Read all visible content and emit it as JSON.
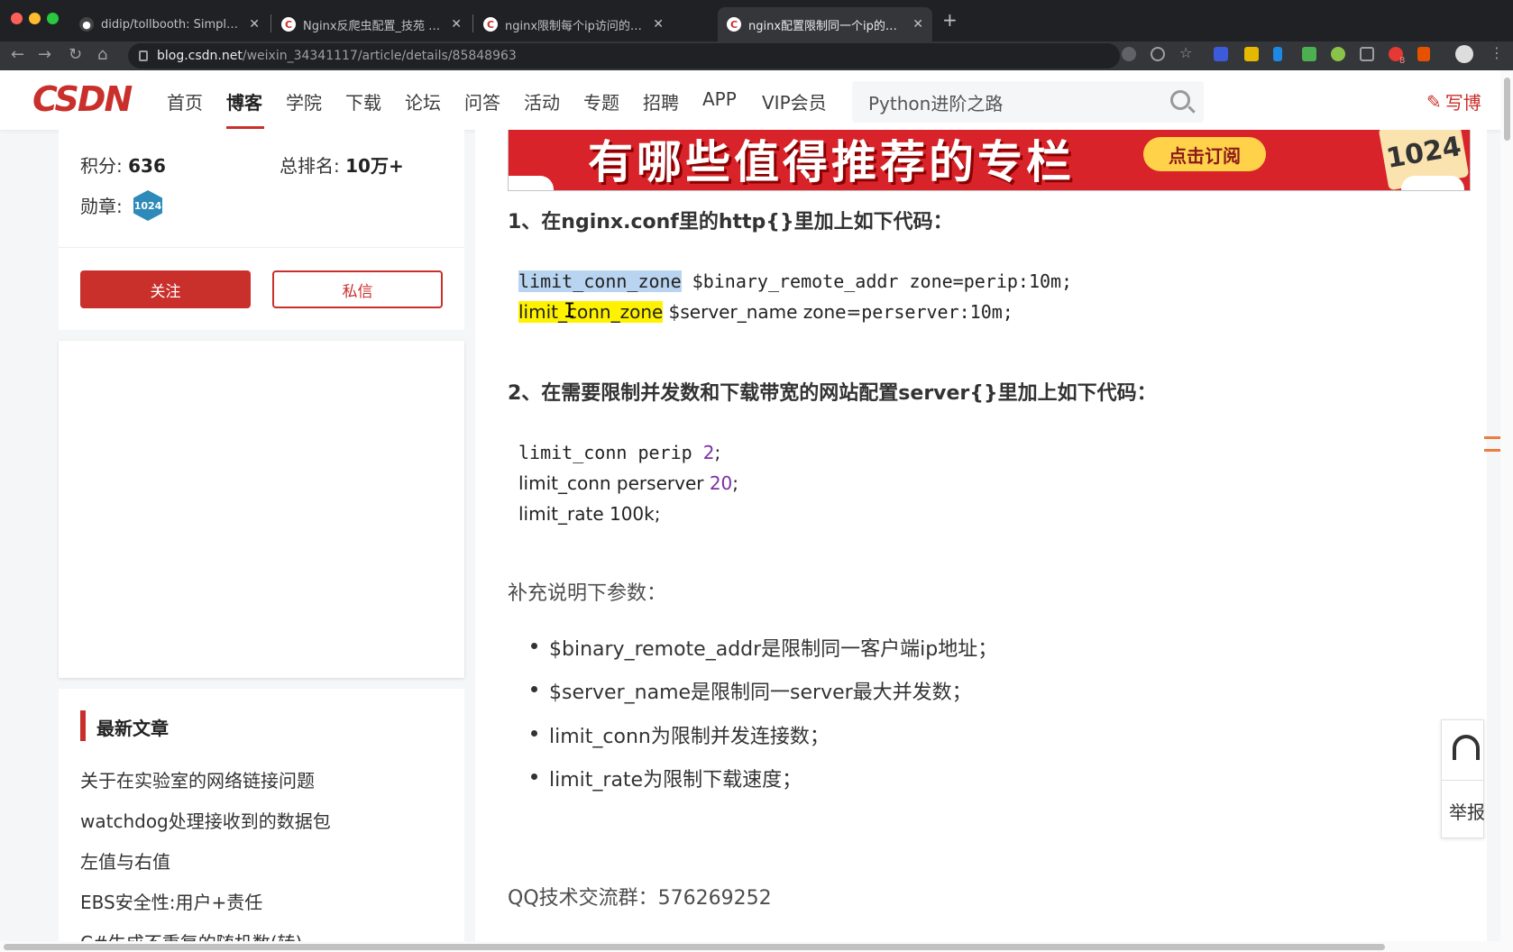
{
  "browser": {
    "tabs": [
      {
        "title": "didip/tollbooth: Simple middlew",
        "favicon": "github-icon"
      },
      {
        "title": "Nginx反爬虫配置_技苑 | pengxi",
        "favicon": "csdn-icon"
      },
      {
        "title": "nginx限制每个ip访问的频率和并",
        "favicon": "csdn-icon"
      },
      {
        "title": "nginx配置限制同一个ip的访问频",
        "favicon": "csdn-icon"
      }
    ],
    "active_tab_index": 3,
    "url_host": "blog.csdn.net",
    "url_path": "/weixin_34341117/article/details/85848963",
    "ext_badge": "8"
  },
  "header": {
    "logo": "CSDN",
    "nav": [
      "首页",
      "博客",
      "学院",
      "下载",
      "论坛",
      "问答",
      "活动",
      "专题",
      "招聘",
      "APP",
      "VIP会员"
    ],
    "active_nav": "博客",
    "search_placeholder": "Python进阶之路",
    "write_label": "写博"
  },
  "sidebar": {
    "score_label": "积分:",
    "score_value": "636",
    "rank_label": "总排名:",
    "rank_value": "10万+",
    "medal_label": "勋章:",
    "medal_badge": "1024",
    "follow_button": "关注",
    "message_button": "私信",
    "recent_title": "最新文章",
    "recent_articles": [
      "关于在实验室的网络链接问题",
      "watchdog处理接收到的数据包",
      "左值与右值",
      "EBS安全性:用户+责任",
      "C#生成不重复的随机数(转)"
    ]
  },
  "banner": {
    "text": "有哪些值得推荐的专栏",
    "button": "点击订阅",
    "badge": "1024"
  },
  "article": {
    "heading1": "1、在nginx.conf里的http{}里加上如下代码：",
    "code1_line1_keyword": "limit_conn_zone",
    "code1_line1_rest": " $binary_remote_addr zone=perip:10m;",
    "code1_line2_keyword": "limit_conn_zone",
    "code1_line2_mid": " $server_name zone=",
    "code1_line2_rest": "perserver:10m;",
    "heading2": "2、在需要限制并发数和下载带宽的网站配置server{}里加上如下代码：",
    "code2_line1_text": "limit_conn perip ",
    "code2_line1_num": "2",
    "code2_line2_text": "limit_conn perserver ",
    "code2_line2_num": "20",
    "code2_line3": "limit_rate 100k;",
    "note_title": "补充说明下参数：",
    "bullets": [
      "$binary_remote_addr是限制同一客户端ip地址；",
      "$server_name是限制同一server最大并发数；",
      "limit_conn为限制并发连接数；",
      "limit_rate为限制下载速度；"
    ],
    "qq_group": "QQ技术交流群：576269252"
  },
  "side_tools": {
    "report_label": "举报"
  },
  "colors": {
    "brand_red": "#c9302c",
    "highlight_blue": "#b8d4f0",
    "highlight_yellow": "#fff200",
    "number_purple": "#7b2fa8"
  }
}
